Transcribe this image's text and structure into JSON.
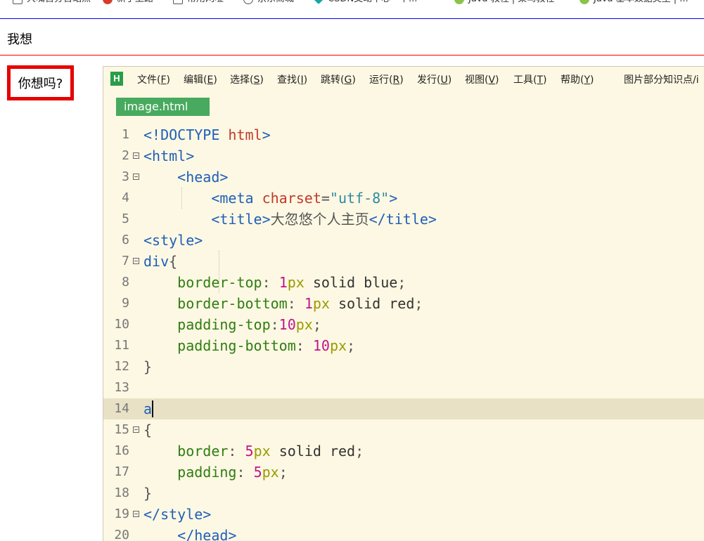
{
  "bookmarks": [
    "大嘴百分百站点",
    "新手上路",
    "常用网址",
    "京东商城",
    "CSDN交动中心 - 中...",
    "Java 教程 | 菜鸟教程",
    "Java 基本数据类型 | ..."
  ],
  "page": {
    "div_text": "我想",
    "link_text": "你想吗?"
  },
  "editor": {
    "logo": "H",
    "menu": [
      {
        "label": "文件(",
        "key": "F",
        "end": ")"
      },
      {
        "label": "编辑(",
        "key": "E",
        "end": ")"
      },
      {
        "label": "选择(",
        "key": "S",
        "end": ")"
      },
      {
        "label": "查找(",
        "key": "I",
        "end": ")"
      },
      {
        "label": "跳转(",
        "key": "G",
        "end": ")"
      },
      {
        "label": "运行(",
        "key": "R",
        "end": ")"
      },
      {
        "label": "发行(",
        "key": "U",
        "end": ")"
      },
      {
        "label": "视图(",
        "key": "V",
        "end": ")"
      },
      {
        "label": "工具(",
        "key": "T",
        "end": ")"
      },
      {
        "label": "帮助(",
        "key": "Y",
        "end": ")"
      }
    ],
    "doc_title": "图片部分知识点/i",
    "tab": "image.html",
    "lines": [
      {
        "n": "1",
        "tokens": [
          [
            "t",
            "<!DOCTYPE "
          ],
          [
            "at",
            "html"
          ],
          [
            "t",
            ">"
          ]
        ]
      },
      {
        "n": "2",
        "tokens": [
          [
            "t",
            "<html>"
          ]
        ]
      },
      {
        "n": "3",
        "tokens": [
          [
            "pc",
            "    "
          ],
          [
            "t",
            "<head>"
          ]
        ]
      },
      {
        "n": "4",
        "tokens": [
          [
            "pc",
            "        "
          ],
          [
            "t",
            "<meta "
          ],
          [
            "at",
            "charset"
          ],
          [
            "pc",
            "="
          ],
          [
            "sv",
            "\"utf-8\""
          ],
          [
            "t",
            ">"
          ]
        ]
      },
      {
        "n": "5",
        "tokens": [
          [
            "pc",
            "        "
          ],
          [
            "t",
            "<title>"
          ],
          [
            "tx",
            "大忽悠个人主页"
          ],
          [
            "t",
            "</title>"
          ]
        ]
      },
      {
        "n": "6",
        "tokens": [
          [
            "t",
            "<style>"
          ]
        ]
      },
      {
        "n": "7",
        "tokens": [
          [
            "sel",
            "div"
          ],
          [
            "pc",
            "{"
          ]
        ]
      },
      {
        "n": "8",
        "tokens": [
          [
            "pc",
            "    "
          ],
          [
            "pr",
            "border-top"
          ],
          [
            "pc",
            ": "
          ],
          [
            "nm",
            "1"
          ],
          [
            "un",
            "px"
          ],
          [
            "kw",
            " solid blue"
          ],
          [
            "pc",
            ";"
          ]
        ]
      },
      {
        "n": "9",
        "tokens": [
          [
            "pc",
            "    "
          ],
          [
            "pr",
            "border-bottom"
          ],
          [
            "pc",
            ": "
          ],
          [
            "nm",
            "1"
          ],
          [
            "un",
            "px"
          ],
          [
            "kw",
            " solid red"
          ],
          [
            "pc",
            ";"
          ]
        ]
      },
      {
        "n": "10",
        "tokens": [
          [
            "pc",
            "    "
          ],
          [
            "pr",
            "padding-top"
          ],
          [
            "pc",
            ":"
          ],
          [
            "nm",
            "10"
          ],
          [
            "un",
            "px"
          ],
          [
            "pc",
            ";"
          ]
        ]
      },
      {
        "n": "11",
        "tokens": [
          [
            "pc",
            "    "
          ],
          [
            "pr",
            "padding-bottom"
          ],
          [
            "pc",
            ": "
          ],
          [
            "nm",
            "10"
          ],
          [
            "un",
            "px"
          ],
          [
            "pc",
            ";"
          ]
        ]
      },
      {
        "n": "12",
        "tokens": [
          [
            "pc",
            "}"
          ]
        ]
      },
      {
        "n": "13",
        "tokens": []
      },
      {
        "n": "14",
        "tokens": [
          [
            "sel",
            "a"
          ]
        ]
      },
      {
        "n": "15",
        "tokens": [
          [
            "pc",
            "{"
          ]
        ]
      },
      {
        "n": "16",
        "tokens": [
          [
            "pc",
            "    "
          ],
          [
            "pr",
            "border"
          ],
          [
            "pc",
            ": "
          ],
          [
            "nm",
            "5"
          ],
          [
            "un",
            "px"
          ],
          [
            "kw",
            " solid red"
          ],
          [
            "pc",
            ";"
          ]
        ]
      },
      {
        "n": "17",
        "tokens": [
          [
            "pc",
            "    "
          ],
          [
            "pr",
            "padding"
          ],
          [
            "pc",
            ": "
          ],
          [
            "nm",
            "5"
          ],
          [
            "un",
            "px"
          ],
          [
            "pc",
            ";"
          ]
        ]
      },
      {
        "n": "18",
        "tokens": [
          [
            "pc",
            "}"
          ]
        ]
      },
      {
        "n": "19",
        "tokens": [
          [
            "t",
            "</style>"
          ]
        ]
      },
      {
        "n": "20",
        "tokens": [
          [
            "pc",
            "    "
          ],
          [
            "t",
            "</head>"
          ]
        ]
      }
    ],
    "fold_lines": [
      "2",
      "3",
      "7",
      "15",
      "19"
    ],
    "active_line": "14"
  }
}
